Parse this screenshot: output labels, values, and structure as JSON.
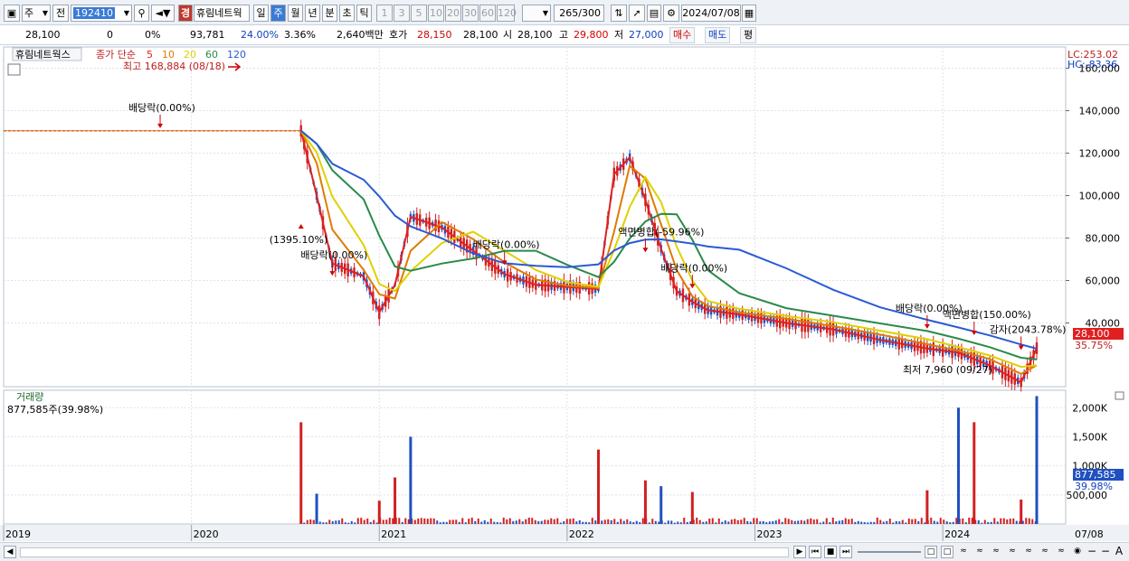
{
  "toolbar": {
    "period_type": "주",
    "prev_label": "전",
    "code": "192410",
    "stock_badge": "경",
    "stock_name": "휴림네트웍",
    "tabs": [
      "일",
      "주",
      "월",
      "년",
      "분",
      "초",
      "틱"
    ],
    "selected_tab": "주",
    "intervals": [
      "1",
      "3",
      "5",
      "10",
      "20",
      "30",
      "60",
      "120"
    ],
    "count": "265",
    "count_total": "/300",
    "date": "2024/07/08"
  },
  "info": {
    "price": "28,100",
    "change": "0",
    "change_pct": "0%",
    "volume": "93,781",
    "vol_ratio": "24.00%",
    "turnover_pct": "3.36%",
    "amount": "2,640백만",
    "ask_label": "호가",
    "ask": "28,150",
    "bid": "28,100",
    "open_label": "시",
    "open": "28,100",
    "high_label": "고",
    "high": "29,800",
    "low_label": "저",
    "low": "27,000",
    "buy_label": "매수",
    "sell_label": "매도",
    "flat_label": "평"
  },
  "legend": {
    "title": "휴림네트웍스",
    "type": "종가 단순",
    "ma": [
      "5",
      "10",
      "20",
      "60",
      "120"
    ],
    "ma_colors": [
      "#e02020",
      "#e07a00",
      "#e0d000",
      "#2a8a4a",
      "#2a5ad5"
    ],
    "high_note": "최고 168,884 (08/18)",
    "low_note": "최저 7,960 (09/27)",
    "lc": "LC:253.02",
    "hc": "HC:-83.36"
  },
  "annotations": [
    {
      "text": "배당락(0.00%)"
    },
    {
      "text": "(1395.10%)"
    },
    {
      "text": "배당락(0.00%)"
    },
    {
      "text": "배당락(0.00%)"
    },
    {
      "text": "액면병합(-59.96%)"
    },
    {
      "text": "배당락(0.00%)"
    },
    {
      "text": "배당락(0.00%)"
    },
    {
      "text": "액면병합(150.00%)"
    },
    {
      "text": "감자(2043.78%)"
    }
  ],
  "price_tag": {
    "value": "28,100",
    "pct": "35.75%"
  },
  "volume_panel": {
    "title": "거래량",
    "value_note": "877,585주(39.98%)",
    "tag_value": "877,585",
    "tag_pct": "39.98%"
  },
  "x_labels": [
    "2019",
    "2020",
    "2021",
    "2022",
    "2023",
    "2024",
    "07/08"
  ],
  "chart_data": [
    {
      "type": "line",
      "title": "휴림네트웍스",
      "y_ticks": [
        40000,
        60000,
        80000,
        100000,
        120000,
        140000,
        160000
      ],
      "y_tick_labels": [
        "40,000",
        "60,000",
        "80,000",
        "100,000",
        "120,000",
        "140,000",
        "160,000"
      ],
      "ylim": [
        10000,
        170000
      ],
      "x": [
        "2019-01",
        "2019-06",
        "2019-11",
        "2020-08",
        "2020-09",
        "2020-10",
        "2020-12",
        "2021-01",
        "2021-02",
        "2021-03",
        "2021-05",
        "2021-07",
        "2021-09",
        "2021-11",
        "2022-01",
        "2022-03",
        "2022-04",
        "2022-05",
        "2022-06",
        "2022-07",
        "2022-08",
        "2022-09",
        "2022-10",
        "2022-12",
        "2023-03",
        "2023-06",
        "2023-09",
        "2023-12",
        "2024-02",
        "2024-04",
        "2024-06",
        "2024-07"
      ],
      "series": [
        {
          "values": [
            130500,
            130500,
            130500,
            130500,
            100000,
            68000,
            62000,
            45000,
            58000,
            90000,
            85000,
            74000,
            63000,
            58000,
            57000,
            56000,
            110000,
            118000,
            98000,
            75000,
            55000,
            50000,
            46000,
            44000,
            40000,
            37000,
            32000,
            28000,
            26000,
            20000,
            12000,
            28100
          ]
        }
      ]
    },
    {
      "type": "bar",
      "title": "거래량",
      "y_ticks": [
        500000,
        1000000,
        1500000,
        2000000
      ],
      "y_tick_labels": [
        "500,000",
        "1,000K",
        "1,500K",
        "2,000K"
      ],
      "ylim": [
        0,
        2300000
      ],
      "categories": [
        "2020-08",
        "2020-09",
        "2021-01",
        "2021-02",
        "2021-03",
        "2022-03",
        "2022-06",
        "2022-07",
        "2022-09",
        "2023-12",
        "2024-02",
        "2024-03",
        "2024-06",
        "2024-07"
      ],
      "values": [
        1750000,
        520000,
        400000,
        800000,
        1500000,
        1280000,
        750000,
        650000,
        550000,
        580000,
        2000000,
        1750000,
        420000,
        2200000
      ]
    }
  ]
}
